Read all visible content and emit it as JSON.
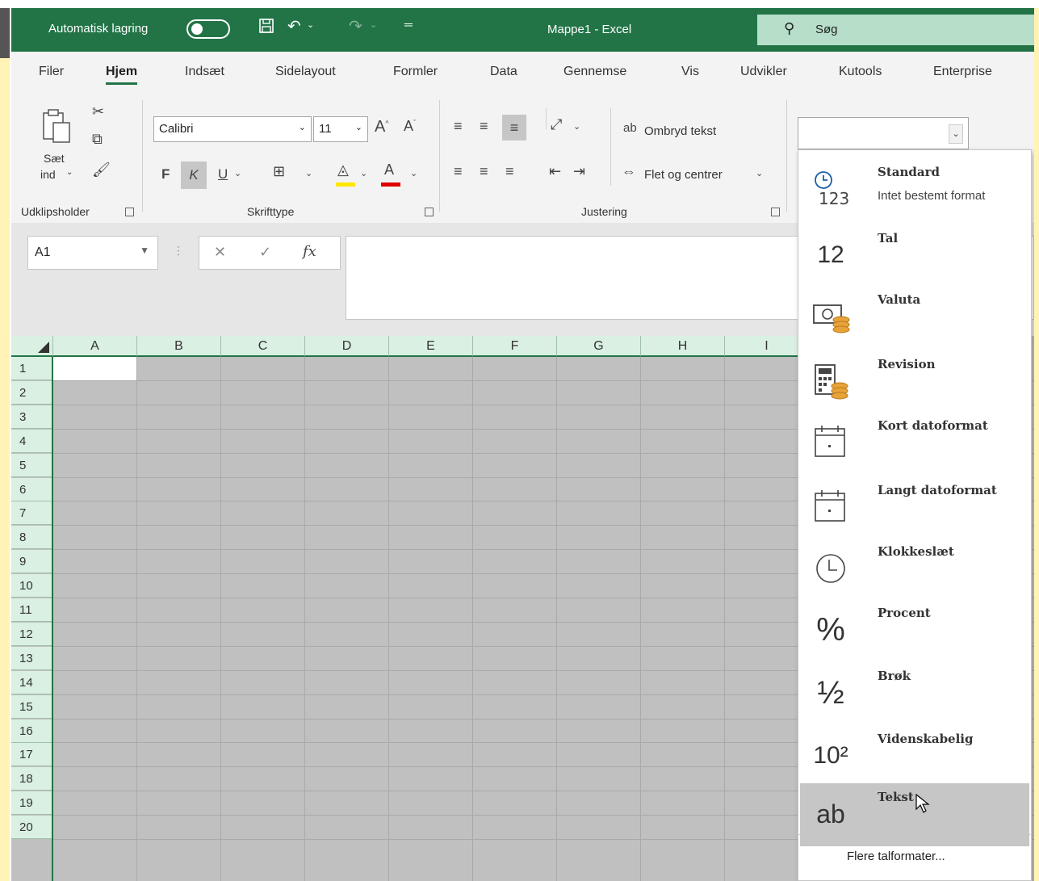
{
  "titlebar": {
    "autosave_label": "Automatisk lagring",
    "doc_title": "Mappe1  -  Excel",
    "search_label": "Søg"
  },
  "tabs": [
    "Filer",
    "Hjem",
    "Indsæt",
    "Sidelayout",
    "Formler",
    "Data",
    "Gennemse",
    "Vis",
    "Udvikler",
    "Kutools",
    "Enterprise"
  ],
  "active_tab": "Hjem",
  "ribbon": {
    "clipboard": {
      "paste_label_1": "Sæt",
      "paste_label_2": "ind",
      "group_label": "Udklipsholder"
    },
    "font": {
      "font_name": "Calibri",
      "font_size": "11",
      "bold": "F",
      "italic": "K",
      "underline": "U",
      "group_label": "Skrifttype"
    },
    "alignment": {
      "wrap_text": "Ombryd tekst",
      "merge_center": "Flet og centrer",
      "group_label": "Justering"
    }
  },
  "formula_bar": {
    "name_box": "A1",
    "fx": "fx"
  },
  "grid": {
    "columns": [
      "A",
      "B",
      "C",
      "D",
      "E",
      "F",
      "G",
      "H",
      "I"
    ],
    "rows": [
      "1",
      "2",
      "3",
      "4",
      "5",
      "6",
      "7",
      "8",
      "9",
      "10",
      "11",
      "12",
      "13",
      "14",
      "15",
      "16",
      "17",
      "18",
      "19",
      "20"
    ]
  },
  "number_format_menu": {
    "items": [
      {
        "title": "Standard",
        "subtitle": "Intet bestemt format",
        "icon": "clock-123-icon"
      },
      {
        "title": "Tal",
        "subtitle": "",
        "icon": "number-12-icon",
        "glyph": "12"
      },
      {
        "title": "Valuta",
        "subtitle": "",
        "icon": "currency-icon"
      },
      {
        "title": "Revision",
        "subtitle": "",
        "icon": "calculator-icon"
      },
      {
        "title": "Kort datoformat",
        "subtitle": "",
        "icon": "short-date-icon"
      },
      {
        "title": "Langt datoformat",
        "subtitle": "",
        "icon": "long-date-icon"
      },
      {
        "title": "Klokkeslæt",
        "subtitle": "",
        "icon": "clock-icon"
      },
      {
        "title": "Procent",
        "subtitle": "",
        "icon": "percent-icon",
        "glyph": "%"
      },
      {
        "title": "Brøk",
        "subtitle": "",
        "icon": "fraction-icon",
        "glyph": "½"
      },
      {
        "title": "Videnskabelig",
        "subtitle": "",
        "icon": "scientific-icon",
        "glyph": "10²"
      },
      {
        "title": "Tekst",
        "subtitle": "",
        "icon": "text-ab-icon",
        "glyph": "ab"
      }
    ],
    "hovered": "Tekst",
    "footer": "Flere talformater..."
  },
  "colors": {
    "excel_green": "#227447",
    "search_bg": "#b6dec9",
    "header_bg": "#d9f0e2",
    "grid_bg": "#c0c0c0",
    "hover": "#c6c6c6"
  }
}
